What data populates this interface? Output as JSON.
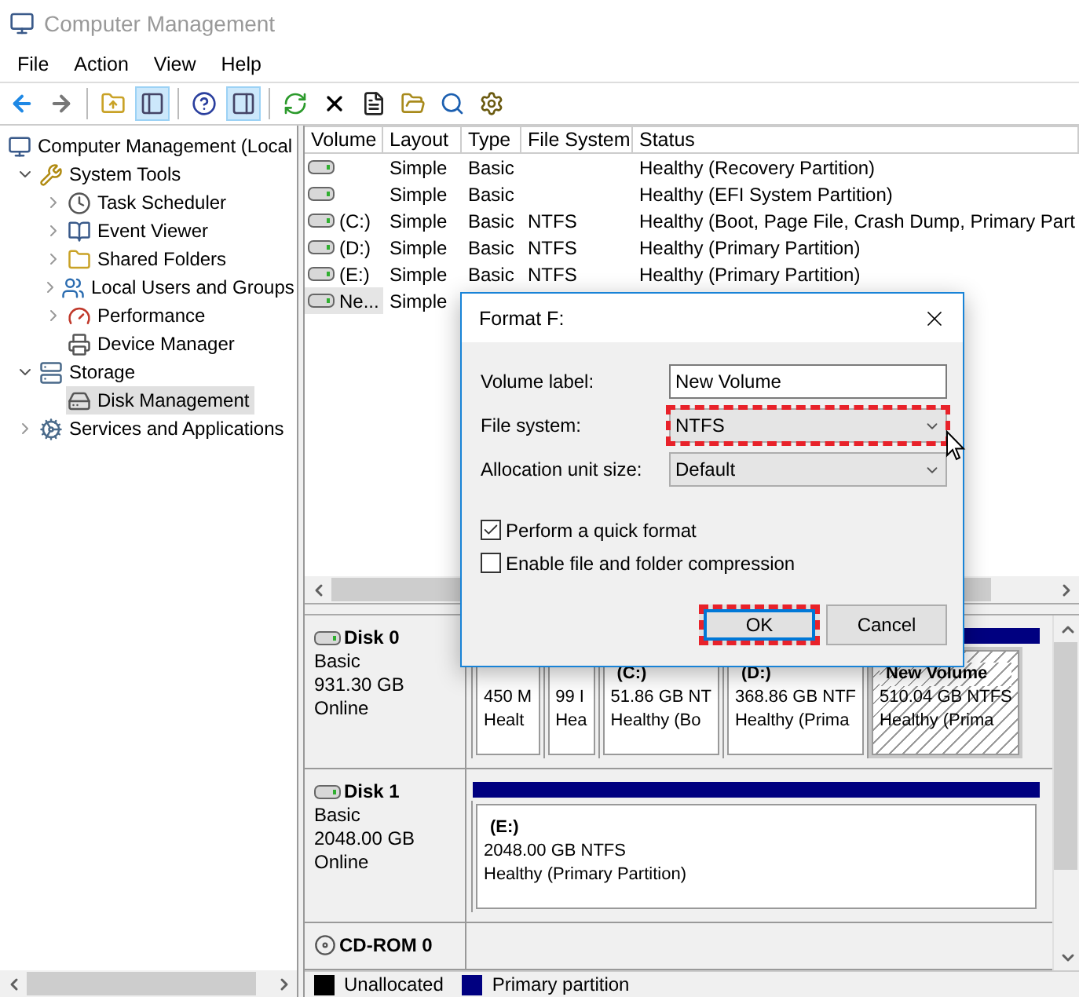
{
  "window": {
    "title": "Computer Management"
  },
  "menu": [
    "File",
    "Action",
    "View",
    "Help"
  ],
  "toolbar": [
    {
      "kind": "back",
      "pressed": false
    },
    {
      "kind": "forward",
      "pressed": false
    },
    {
      "kind": "sep"
    },
    {
      "kind": "up",
      "pressed": false
    },
    {
      "kind": "tree",
      "pressed": true
    },
    {
      "kind": "sep"
    },
    {
      "kind": "help",
      "pressed": false
    },
    {
      "kind": "pane",
      "pressed": true
    },
    {
      "kind": "sep"
    },
    {
      "kind": "refresh",
      "pressed": false
    },
    {
      "kind": "delete",
      "pressed": false
    },
    {
      "kind": "properties",
      "pressed": false
    },
    {
      "kind": "open",
      "pressed": false
    },
    {
      "kind": "search",
      "pressed": false
    },
    {
      "kind": "settings",
      "pressed": false
    }
  ],
  "tree": [
    {
      "label": "Computer Management (Local",
      "kind": "computer",
      "selected": false,
      "children": [
        {
          "label": "System Tools",
          "kind": "tools",
          "expanded": true,
          "selected": false,
          "children": [
            {
              "label": "Task Scheduler",
              "kind": "clock",
              "expanded": false,
              "selected": false
            },
            {
              "label": "Event Viewer",
              "kind": "log",
              "expanded": false,
              "selected": false
            },
            {
              "label": "Shared Folders",
              "kind": "folder",
              "expanded": false,
              "selected": false
            },
            {
              "label": "Local Users and Groups",
              "kind": "users",
              "expanded": false,
              "selected": false
            },
            {
              "label": "Performance",
              "kind": "gauge",
              "expanded": false,
              "selected": false
            },
            {
              "label": "Device Manager",
              "kind": "device",
              "selected": false
            }
          ]
        },
        {
          "label": "Storage",
          "kind": "storage",
          "expanded": true,
          "selected": false,
          "children": [
            {
              "label": "Disk Management",
              "kind": "disk",
              "selected": true
            }
          ]
        },
        {
          "label": "Services and Applications",
          "kind": "services",
          "expanded": false,
          "selected": false
        }
      ]
    }
  ],
  "table": {
    "columns": [
      "Volume",
      "Layout",
      "Type",
      "File System",
      "Status"
    ],
    "rows": [
      {
        "layout": "Simple",
        "type": "Basic",
        "status": "Healthy (Recovery Partition)",
        "selected": false
      },
      {
        "layout": "Simple",
        "type": "Basic",
        "status": "Healthy (EFI System Partition)",
        "selected": false
      },
      {
        "volume": "(C:)",
        "layout": "Simple",
        "type": "Basic",
        "file_system": "NTFS",
        "status": "Healthy (Boot, Page File, Crash Dump, Primary Part",
        "selected": false
      },
      {
        "volume": "(D:)",
        "layout": "Simple",
        "type": "Basic",
        "file_system": "NTFS",
        "status": "Healthy (Primary Partition)",
        "selected": false
      },
      {
        "volume": "(E:)",
        "layout": "Simple",
        "type": "Basic",
        "file_system": "NTFS",
        "status": "Healthy (Primary Partition)",
        "selected": false
      },
      {
        "volume": "Ne...",
        "layout": "Simple",
        "selected": true
      }
    ]
  },
  "disks": [
    {
      "name": "Disk 0",
      "kind": "disk",
      "type": "Basic",
      "size": "931.30 GB",
      "status": "Online",
      "partitions": [
        {
          "lines": [
            "450 M",
            "Healt"
          ],
          "selected": false
        },
        {
          "lines": [
            "99 I",
            "Hea"
          ],
          "selected": false
        },
        {
          "title": "(C:)",
          "lines": [
            "51.86 GB NT",
            "Healthy (Bo"
          ],
          "selected": false
        },
        {
          "title": "(D:)",
          "lines": [
            "368.86 GB NTF",
            "Healthy (Prima"
          ],
          "selected": false
        },
        {
          "title": "New Volume",
          "lines": [
            "510.04 GB NTFS",
            "Healthy (Prima"
          ],
          "selected": true
        }
      ]
    },
    {
      "name": "Disk 1",
      "kind": "disk",
      "type": "Basic",
      "size": "2048.00 GB",
      "status": "Online",
      "partitions": [
        {
          "title": "(E:)",
          "lines": [
            "2048.00 GB NTFS",
            "Healthy (Primary Partition)"
          ],
          "selected": false
        }
      ]
    },
    {
      "name": "CD-ROM 0",
      "kind": "cdrom"
    }
  ],
  "legend": [
    {
      "label": "Unallocated",
      "color": "#000000"
    },
    {
      "label": "Primary partition",
      "color": "#000080"
    }
  ],
  "dialog": {
    "title": "Format F:",
    "fields": [
      {
        "kind": "text",
        "label": "Volume label:",
        "value": "New Volume",
        "highlighted": false
      },
      {
        "kind": "select",
        "label": "File system:",
        "value": "NTFS",
        "highlighted": true
      },
      {
        "kind": "select",
        "label": "Allocation unit size:",
        "value": "Default",
        "highlighted": false
      }
    ],
    "options": [
      {
        "label": "Perform a quick format",
        "checked": true
      },
      {
        "label": "Enable file and folder compression",
        "checked": false
      }
    ],
    "buttons": [
      {
        "label": "OK",
        "default": true,
        "highlighted": true
      },
      {
        "label": "Cancel",
        "default": false,
        "highlighted": false
      }
    ]
  }
}
